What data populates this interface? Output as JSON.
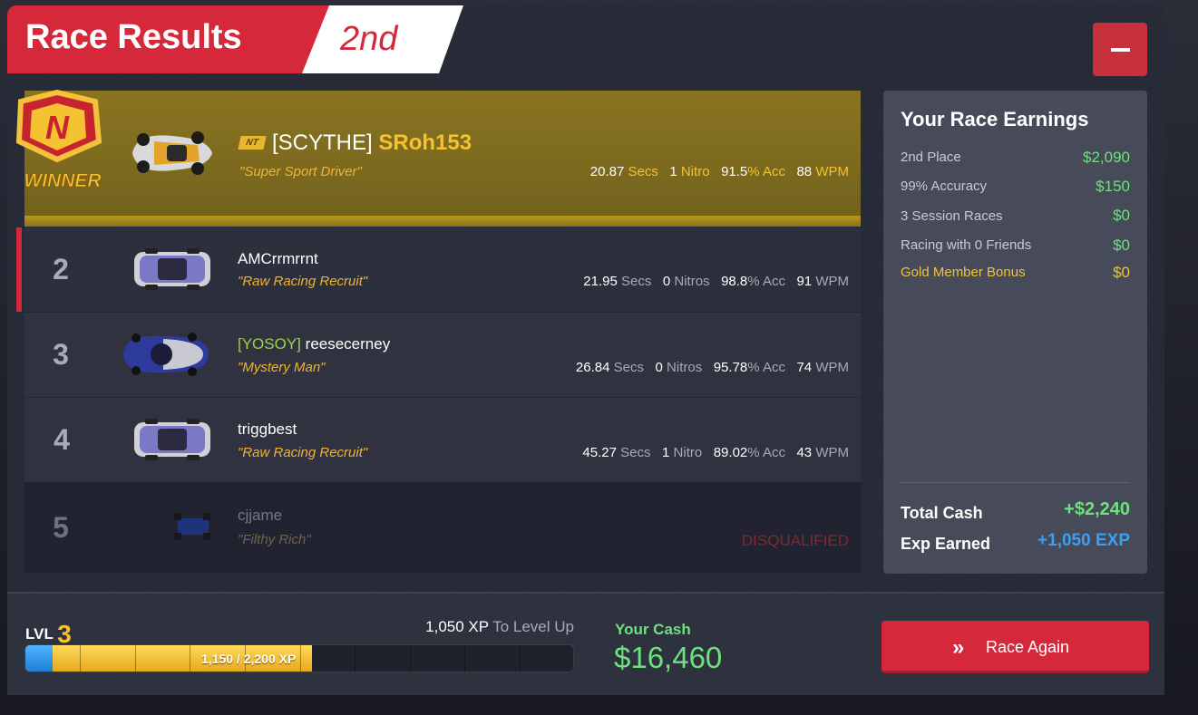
{
  "header": {
    "title": "Race Results",
    "place": "2nd",
    "minimize_label": "–"
  },
  "winner": {
    "badge_text": "WINNER",
    "badge_letter": "N",
    "team_logo": "NT",
    "tag": "[SCYTHE]",
    "name": "SRoh153",
    "title": "\"Super Sport Driver\"",
    "secs": "20.87",
    "secs_unit": "Secs",
    "nitro": "1",
    "nitro_unit": "Nitro",
    "acc": "91.5",
    "acc_unit": "% Acc",
    "wpm": "88",
    "wpm_unit": "WPM"
  },
  "racers": [
    {
      "pos": "2",
      "tag": "",
      "name": "AMCrrmrrnt",
      "title": "\"Raw Racing Recruit\"",
      "secs": "21.95",
      "secs_unit": "Secs",
      "nitro": "0",
      "nitro_unit": "Nitros",
      "acc": "98.8",
      "acc_unit": "% Acc",
      "wpm": "91",
      "wpm_unit": "WPM"
    },
    {
      "pos": "3",
      "tag": "[YOSOY]",
      "name": "reesecerney",
      "title": "\"Mystery Man\"",
      "secs": "26.84",
      "secs_unit": "Secs",
      "nitro": "0",
      "nitro_unit": "Nitros",
      "acc": "95.78",
      "acc_unit": "% Acc",
      "wpm": "74",
      "wpm_unit": "WPM"
    },
    {
      "pos": "4",
      "tag": "",
      "name": "triggbest",
      "title": "\"Raw Racing Recruit\"",
      "secs": "45.27",
      "secs_unit": "Secs",
      "nitro": "1",
      "nitro_unit": "Nitro",
      "acc": "89.02",
      "acc_unit": "% Acc",
      "wpm": "43",
      "wpm_unit": "WPM"
    },
    {
      "pos": "5",
      "name": "cjjame",
      "title": "\"Filthy Rich\"",
      "status": "DISQUALIFIED"
    }
  ],
  "earnings": {
    "heading": "Your Race Earnings",
    "items": [
      {
        "label": "2nd Place",
        "value": "$2,090"
      },
      {
        "label": "99% Accuracy",
        "value": "$150"
      },
      {
        "label": "3 Session Races",
        "value": "$0"
      },
      {
        "label": "Racing with 0 Friends",
        "value": "$0"
      },
      {
        "label": "Gold Member Bonus",
        "value": "$0"
      }
    ],
    "total_cash_label": "Total Cash",
    "total_cash": "+$2,240",
    "exp_label": "Exp Earned",
    "exp": "+1,050 EXP"
  },
  "footer": {
    "lvl_label": "LVL",
    "lvl": "3",
    "to_level_value": "1,050 XP",
    "to_level_text": "To Level Up",
    "xp_text": "1,150 / 2,200 XP",
    "xp_fraction": 0.523,
    "cash_label": "Your Cash",
    "cash": "$16,460",
    "race_again": "Race Again",
    "race_again_icon": "»"
  },
  "colors": {
    "accent_red": "#d6283b",
    "gold": "#f5c231",
    "cash_green": "#6fe07f",
    "exp_blue": "#3b9ff2"
  }
}
